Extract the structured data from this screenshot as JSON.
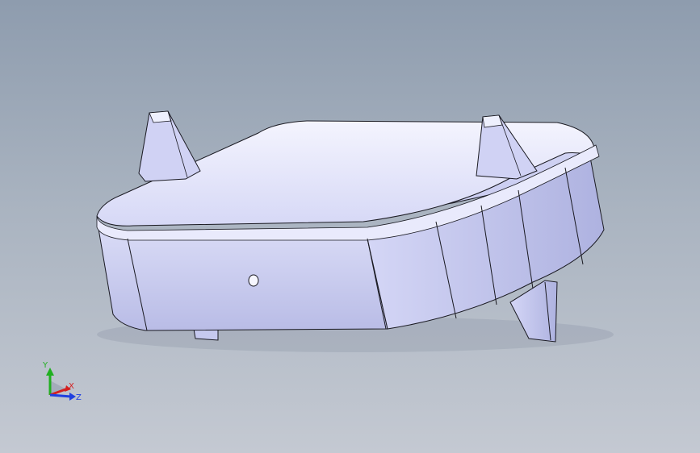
{
  "viewport": {
    "background_top": "#8e9cae",
    "background_bottom": "#c4c9d2",
    "model_color": "#cbcdf0",
    "edge_color": "#1a1a22"
  },
  "triad": {
    "x_label": "X",
    "y_label": "Y",
    "z_label": "Z",
    "x_color": "#d42020",
    "y_color": "#20b020",
    "z_color": "#2040e0"
  }
}
